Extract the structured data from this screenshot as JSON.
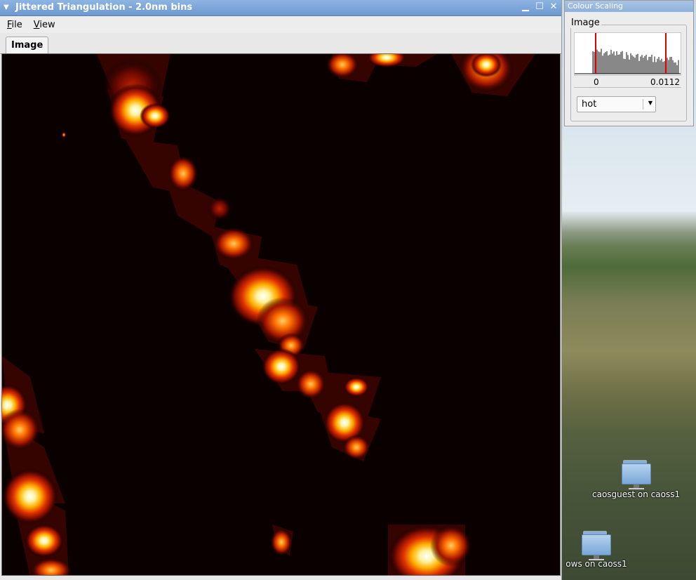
{
  "main_window": {
    "title": "Jittered Triangulation - 2.0nm bins",
    "menu": [
      "File",
      "View"
    ],
    "tabs": [
      "Image"
    ]
  },
  "colour_scaling": {
    "title": "Colour Scaling",
    "group_label": "Image",
    "hist_min": "0",
    "hist_max": "0.0112",
    "colormap": "hot"
  },
  "desktop": {
    "icons": [
      {
        "label": "caosguest on caoss1",
        "icon": "network-folder-icon"
      },
      {
        "label": "ows on caoss1",
        "icon": "network-folder-icon"
      }
    ]
  },
  "colors": {
    "titlebar": "#6e98cf",
    "image_background": "#000000",
    "hot_low": "#8b0a00",
    "hot_mid": "#ff6a00",
    "hot_high": "#ffffe0",
    "clip_markers": "#e00000"
  }
}
